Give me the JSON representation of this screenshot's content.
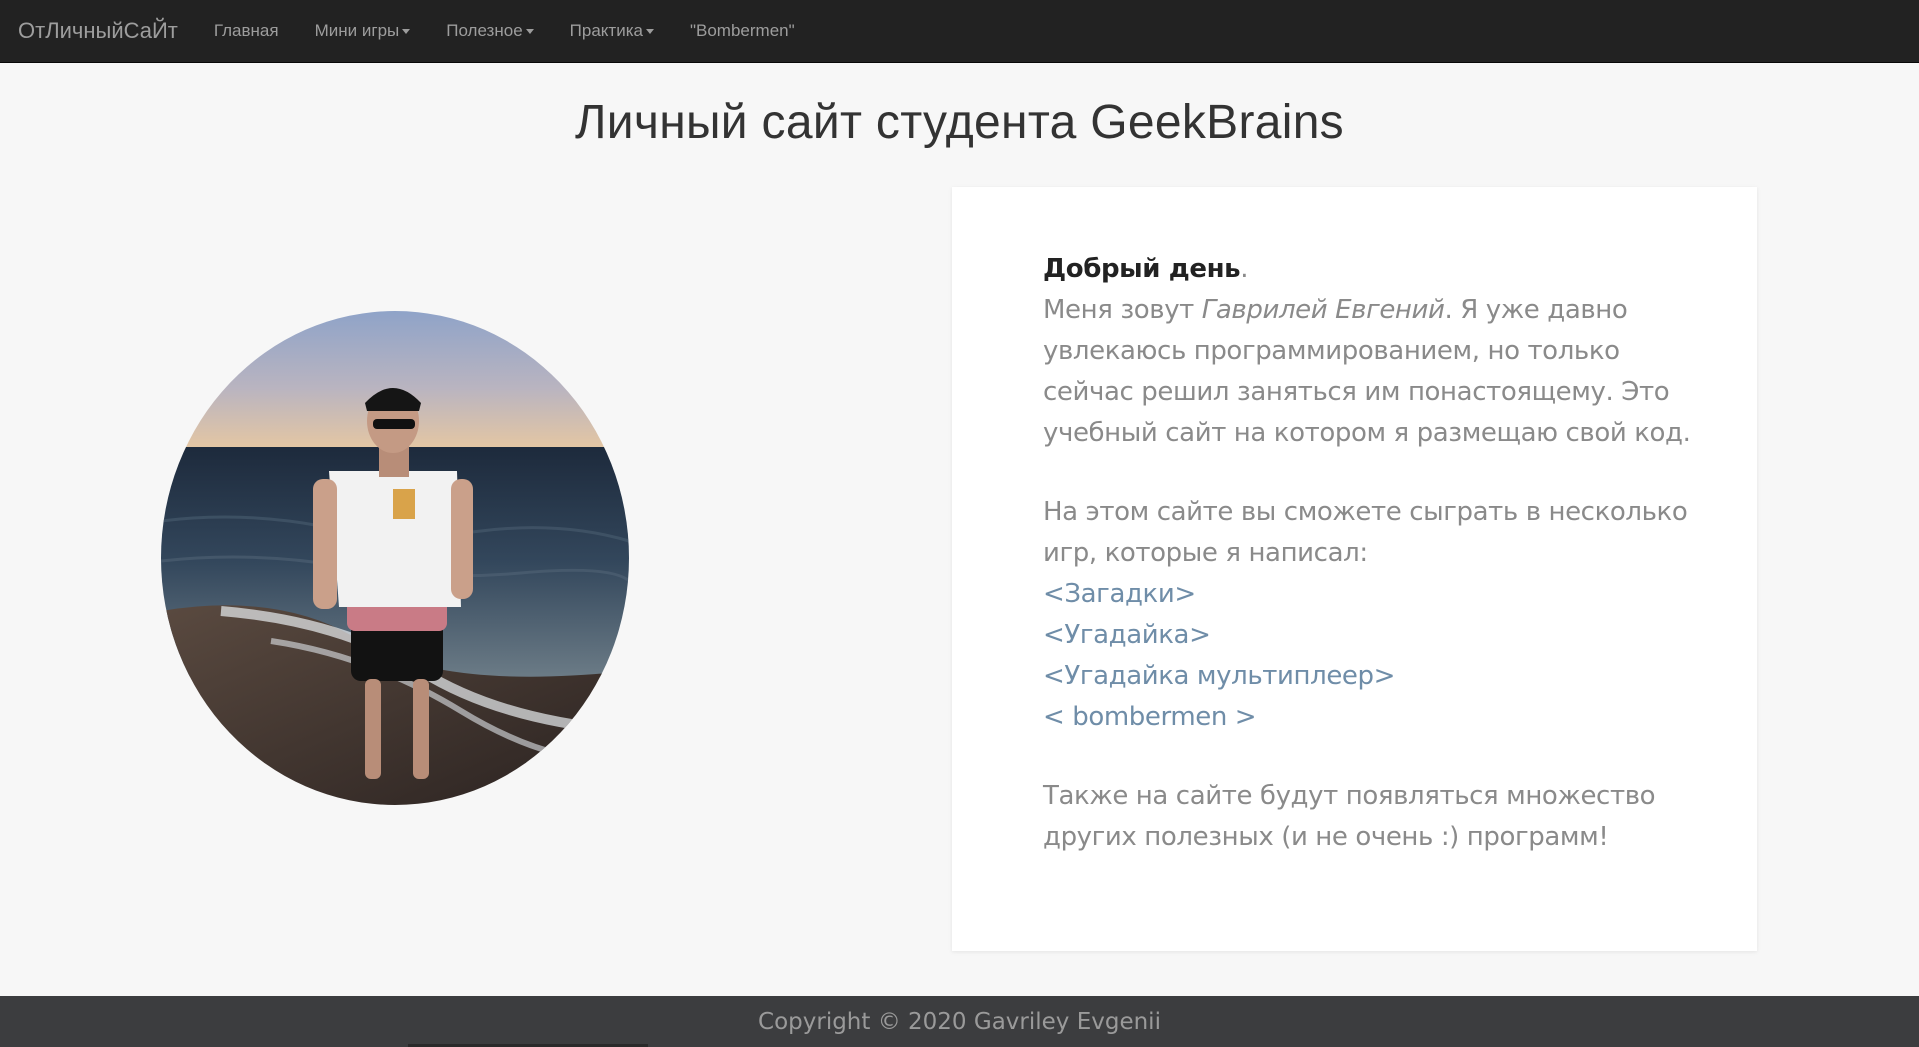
{
  "navbar": {
    "brand": "ОтЛичныйСаЙт",
    "items": [
      {
        "label": "Главная",
        "dropdown": false
      },
      {
        "label": "Мини игры",
        "dropdown": true
      },
      {
        "label": "Полезное",
        "dropdown": true
      },
      {
        "label": "Практика",
        "dropdown": true
      },
      {
        "label": "\"Bombermen\"",
        "dropdown": false
      }
    ]
  },
  "page_title": "Личный сайт студента GeekBrains",
  "card": {
    "greeting": "Добрый день",
    "greeting_punct": ".",
    "intro_before_name": "Меня зовут ",
    "name": "Гаврилей Евгений",
    "intro_after_name": ". Я уже давно увлекаюсь программированием, но только сейчас решил заняться им понастоящему. Это учебный сайт на котором я размещаю свой код.",
    "games_intro": "На этом сайте вы сможете сыграть в несколько игр, которые я написал:",
    "games": [
      "<Загадки>",
      "<Угадайка>",
      "<Угадайка мультиплеер>",
      "< bombermen >"
    ],
    "outro": "Также на сайте будут появляться множество других полезных (и не очень :) программ!"
  },
  "footer": {
    "copyright": "Copyright © 2020 Gavriley Evgenii"
  },
  "colors": {
    "navbar_bg": "#222222",
    "nav_text": "#9d9d9d",
    "page_bg": "#f7f7f7",
    "card_bg": "#ffffff",
    "link": "#6f8da8",
    "footer_bg": "#3c3d3f"
  }
}
